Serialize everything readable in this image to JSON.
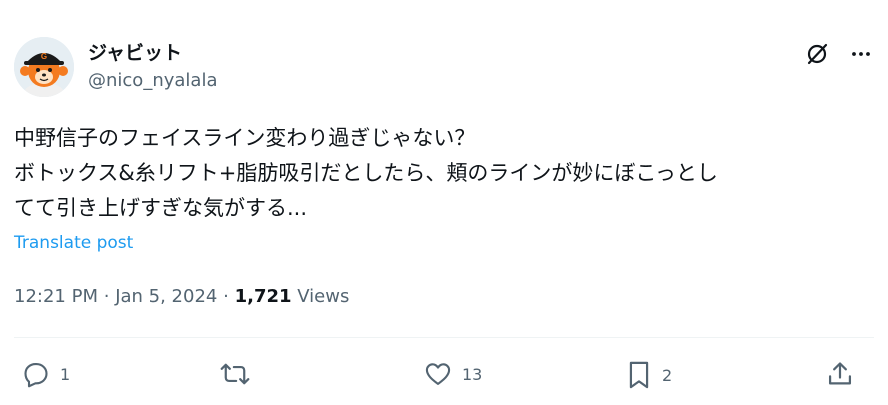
{
  "author": {
    "display_name": "ジャビット",
    "handle": "@nico_nyalala"
  },
  "tweet": {
    "lines": [
      "中野信子のフェイスライン変わり過ぎじゃない？",
      "ボトックス&糸リフト+脂肪吸引だとしたら、頬のラインが妙にぼこっとし",
      "てて引き上げすぎな気がする..."
    ]
  },
  "translate_label": "Translate post",
  "meta": {
    "time": "12:21 PM",
    "date": "Jan 5, 2024",
    "separator": "·",
    "views_count": "1,721",
    "views_label": "Views"
  },
  "actions": {
    "reply_count": "1",
    "repost_count": "",
    "like_count": "13",
    "bookmark_count": "2"
  },
  "icons": {
    "grok": "grok-icon",
    "more": "more-icon",
    "reply": "reply-icon",
    "repost": "repost-icon",
    "like": "like-icon",
    "bookmark": "bookmark-icon",
    "share": "share-icon"
  },
  "colors": {
    "text": "#0f1419",
    "secondary": "#536471",
    "link": "#1d9bf0",
    "divider": "#eff3f4"
  }
}
